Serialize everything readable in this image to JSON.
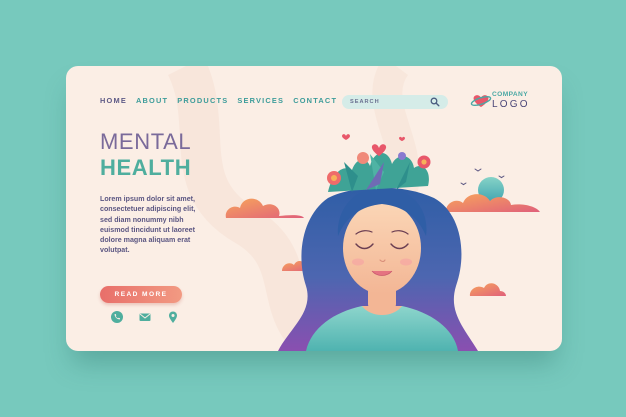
{
  "nav": {
    "items": [
      {
        "label": "HOME",
        "active": true
      },
      {
        "label": "ABOUT",
        "active": false
      },
      {
        "label": "PRODUCTS",
        "active": false
      },
      {
        "label": "SERVICES",
        "active": false
      },
      {
        "label": "CONTACT",
        "active": false
      }
    ]
  },
  "search": {
    "placeholder": "SEARCH",
    "icon": "search-icon"
  },
  "logo": {
    "line1": "COMPANY",
    "line2": "LOGO",
    "icon": "heart-planet-icon"
  },
  "hero": {
    "title_line1": "MENTAL",
    "title_line2": "HEALTH",
    "body": "Lorem ipsum dolor sit amet, consectetuer adipiscing elit, sed diam nonummy nibh euismod tincidunt ut laoreet dolore magna aliquam erat volutpat.",
    "button_label": "READ MORE"
  },
  "contact_icons": [
    "phone-icon",
    "mail-icon",
    "location-pin-icon"
  ],
  "colors": {
    "background": "#77c9bd",
    "card": "#fbeee5",
    "accent_teal": "#4fae9e",
    "accent_purple": "#5e5a86",
    "button_start": "#e86f6a",
    "button_end": "#f29a82"
  }
}
